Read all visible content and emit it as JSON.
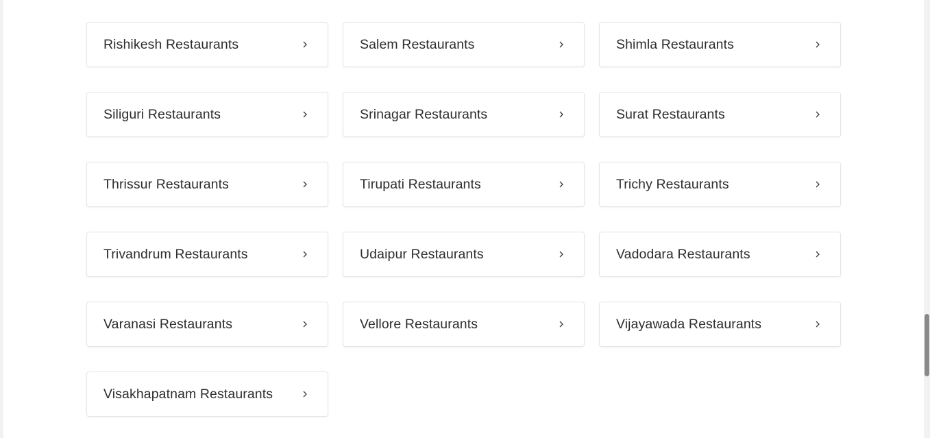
{
  "cities": [
    {
      "label": "Rishikesh Restaurants"
    },
    {
      "label": "Salem Restaurants"
    },
    {
      "label": "Shimla Restaurants"
    },
    {
      "label": "Siliguri Restaurants"
    },
    {
      "label": "Srinagar Restaurants"
    },
    {
      "label": "Surat Restaurants"
    },
    {
      "label": "Thrissur Restaurants"
    },
    {
      "label": "Tirupati Restaurants"
    },
    {
      "label": "Trichy Restaurants"
    },
    {
      "label": "Trivandrum Restaurants"
    },
    {
      "label": "Udaipur Restaurants"
    },
    {
      "label": "Vadodara Restaurants"
    },
    {
      "label": "Varanasi Restaurants"
    },
    {
      "label": "Vellore Restaurants"
    },
    {
      "label": "Vijayawada Restaurants"
    },
    {
      "label": "Visakhapatnam Restaurants"
    }
  ],
  "icons": {
    "card_arrow": "chevron-right-icon"
  },
  "colors": {
    "text": "#2d2d2d",
    "card_border": "#e6e6e6",
    "scrollbar_thumb": "#8a8a8a"
  }
}
